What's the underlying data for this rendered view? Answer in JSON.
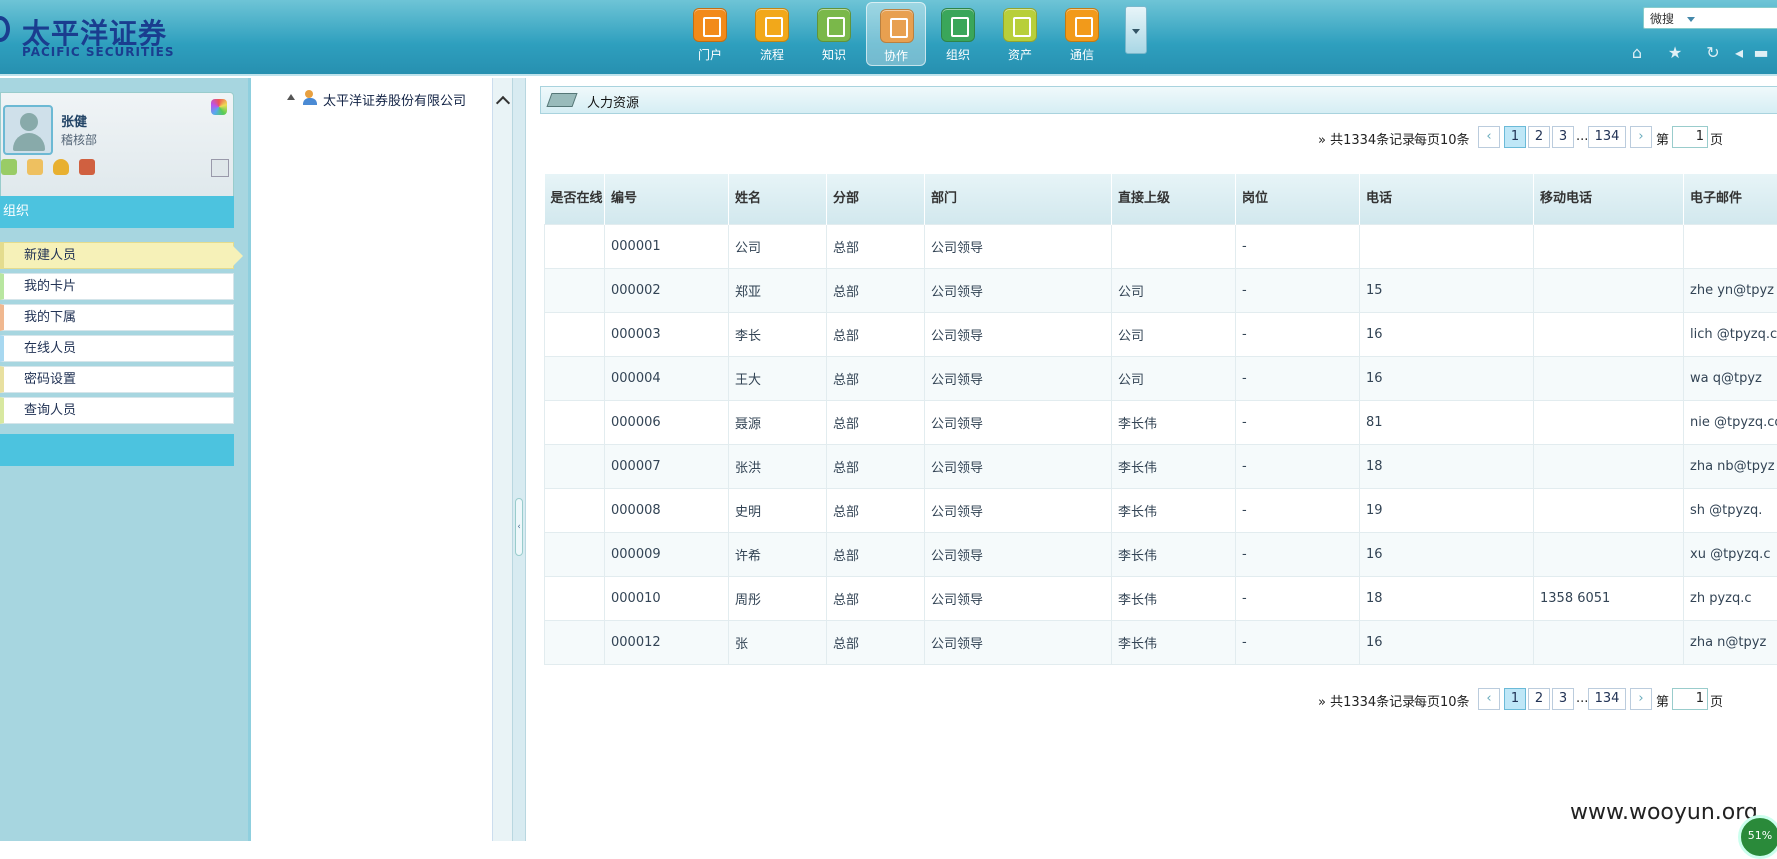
{
  "header": {
    "logo_cn": "太平洋证券",
    "logo_en": "PACIFIC SECURITIES",
    "nav": [
      {
        "label": "门户",
        "color": "#f28a1a"
      },
      {
        "label": "流程",
        "color": "#f2a81a"
      },
      {
        "label": "知识",
        "color": "#7ab84a"
      },
      {
        "label": "协作",
        "color": "#e8a050"
      },
      {
        "label": "组织",
        "color": "#3aa65a"
      },
      {
        "label": "资产",
        "color": "#b8cf3a"
      },
      {
        "label": "通信",
        "color": "#f29a1a"
      }
    ],
    "active_nav": "协作",
    "search_select": "微搜"
  },
  "sidebar": {
    "user_name": "张健",
    "user_dept": "稽核部",
    "section_title": "组织",
    "menu": [
      {
        "label": "新建人员"
      },
      {
        "label": "我的卡片"
      },
      {
        "label": "我的下属"
      },
      {
        "label": "在线人员"
      },
      {
        "label": "密码设置"
      },
      {
        "label": "查询人员"
      }
    ]
  },
  "tree": {
    "root_label": "太平洋证券股份有限公司"
  },
  "panel": {
    "title": "人力资源"
  },
  "pager": {
    "total": "» 共1334条记录",
    "per_page": "每页10条",
    "pages": [
      "1",
      "2",
      "3"
    ],
    "ellipsis": "...",
    "last_page": "134",
    "goto_label": "第",
    "current_input": "1",
    "page_suffix": "页"
  },
  "table": {
    "columns": [
      "是否在线",
      "编号",
      "姓名",
      "分部",
      "部门",
      "直接上级",
      "岗位",
      "电话",
      "移动电话",
      "电子邮件"
    ],
    "rows": [
      {
        "online": "",
        "id": "000001",
        "name": "公司",
        "branch": "总部",
        "dept": "公司领导",
        "manager": "",
        "post": "-",
        "phone": "",
        "mobile": "",
        "email": ""
      },
      {
        "online": "",
        "id": "000002",
        "name": "郑亚",
        "branch": "总部",
        "dept": "公司领导",
        "manager": "公司",
        "post": "-",
        "phone": "15",
        "mobile": "",
        "email": "zhe    yn@tpyz"
      },
      {
        "online": "",
        "id": "000003",
        "name": "李长",
        "branch": "总部",
        "dept": "公司领导",
        "manager": "公司",
        "post": "-",
        "phone": "16",
        "mobile": "",
        "email": "lich    @tpyzq.c"
      },
      {
        "online": "",
        "id": "000004",
        "name": "王大",
        "branch": "总部",
        "dept": "公司领导",
        "manager": "公司",
        "post": "-",
        "phone": "16",
        "mobile": "",
        "email": "wa    q@tpyz"
      },
      {
        "online": "",
        "id": "000006",
        "name": "聂源",
        "branch": "总部",
        "dept": "公司领导",
        "manager": "李长伟",
        "post": "-",
        "phone": "81",
        "mobile": "",
        "email": "nie    @tpyzq.co"
      },
      {
        "online": "",
        "id": "000007",
        "name": "张洪",
        "branch": "总部",
        "dept": "公司领导",
        "manager": "李长伟",
        "post": "-",
        "phone": "18",
        "mobile": "",
        "email": "zha    nb@tpyz"
      },
      {
        "online": "",
        "id": "000008",
        "name": "史明",
        "branch": "总部",
        "dept": "公司领导",
        "manager": "李长伟",
        "post": "-",
        "phone": "19",
        "mobile": "",
        "email": "sh    @tpyzq."
      },
      {
        "online": "",
        "id": "000009",
        "name": "许希",
        "branch": "总部",
        "dept": "公司领导",
        "manager": "李长伟",
        "post": "-",
        "phone": "16",
        "mobile": "",
        "email": "xu    @tpyzq.c"
      },
      {
        "online": "",
        "id": "000010",
        "name": "周彤",
        "branch": "总部",
        "dept": "公司领导",
        "manager": "李长伟",
        "post": "-",
        "phone": "18",
        "mobile": "1358    6051",
        "email": "zh    pyzq.c"
      },
      {
        "online": "",
        "id": "000012",
        "name": "张",
        "branch": "总部",
        "dept": "公司领导",
        "manager": "李长伟",
        "post": "-",
        "phone": "16",
        "mobile": "",
        "email": "zha    n@tpyz"
      }
    ]
  },
  "watermark": "www.wooyun.org",
  "badge": "51%"
}
